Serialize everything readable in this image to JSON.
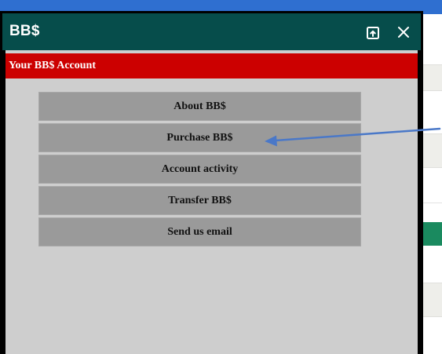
{
  "window": {
    "title": "BB$"
  },
  "section": {
    "header": "Your BB$ Account"
  },
  "menu": {
    "items": [
      {
        "label": "About BB$"
      },
      {
        "label": "Purchase BB$"
      },
      {
        "label": "Account activity"
      },
      {
        "label": "Transfer BB$"
      },
      {
        "label": "Send us email"
      }
    ]
  },
  "icons": {
    "popout": "popout-icon",
    "close": "close-icon",
    "annotation": "annotation-arrow"
  },
  "colors": {
    "titlebar": "#064d4b",
    "section_header": "#cc0000",
    "menu_item": "#9a9a9a",
    "panel_body": "#cecece",
    "annotation_arrow": "#4a78c8"
  }
}
